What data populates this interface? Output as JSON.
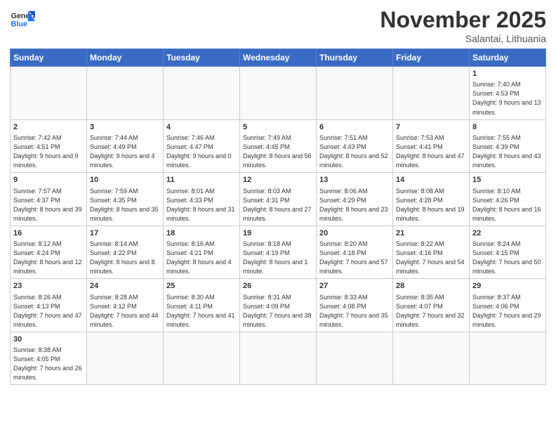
{
  "header": {
    "logo_general": "General",
    "logo_blue": "Blue",
    "month_title": "November 2025",
    "location": "Salantai, Lithuania"
  },
  "days_of_week": [
    "Sunday",
    "Monday",
    "Tuesday",
    "Wednesday",
    "Thursday",
    "Friday",
    "Saturday"
  ],
  "weeks": [
    {
      "days": [
        {
          "num": "",
          "info": ""
        },
        {
          "num": "",
          "info": ""
        },
        {
          "num": "",
          "info": ""
        },
        {
          "num": "",
          "info": ""
        },
        {
          "num": "",
          "info": ""
        },
        {
          "num": "",
          "info": ""
        },
        {
          "num": "1",
          "info": "Sunrise: 7:40 AM\nSunset: 4:53 PM\nDaylight: 9 hours and 13 minutes."
        }
      ]
    },
    {
      "days": [
        {
          "num": "2",
          "info": "Sunrise: 7:42 AM\nSunset: 4:51 PM\nDaylight: 9 hours and 9 minutes."
        },
        {
          "num": "3",
          "info": "Sunrise: 7:44 AM\nSunset: 4:49 PM\nDaylight: 9 hours and 4 minutes."
        },
        {
          "num": "4",
          "info": "Sunrise: 7:46 AM\nSunset: 4:47 PM\nDaylight: 9 hours and 0 minutes."
        },
        {
          "num": "5",
          "info": "Sunrise: 7:49 AM\nSunset: 4:45 PM\nDaylight: 8 hours and 56 minutes."
        },
        {
          "num": "6",
          "info": "Sunrise: 7:51 AM\nSunset: 4:43 PM\nDaylight: 8 hours and 52 minutes."
        },
        {
          "num": "7",
          "info": "Sunrise: 7:53 AM\nSunset: 4:41 PM\nDaylight: 8 hours and 47 minutes."
        },
        {
          "num": "8",
          "info": "Sunrise: 7:55 AM\nSunset: 4:39 PM\nDaylight: 8 hours and 43 minutes."
        }
      ]
    },
    {
      "days": [
        {
          "num": "9",
          "info": "Sunrise: 7:57 AM\nSunset: 4:37 PM\nDaylight: 8 hours and 39 minutes."
        },
        {
          "num": "10",
          "info": "Sunrise: 7:59 AM\nSunset: 4:35 PM\nDaylight: 8 hours and 35 minutes."
        },
        {
          "num": "11",
          "info": "Sunrise: 8:01 AM\nSunset: 4:33 PM\nDaylight: 8 hours and 31 minutes."
        },
        {
          "num": "12",
          "info": "Sunrise: 8:03 AM\nSunset: 4:31 PM\nDaylight: 8 hours and 27 minutes."
        },
        {
          "num": "13",
          "info": "Sunrise: 8:06 AM\nSunset: 4:29 PM\nDaylight: 8 hours and 23 minutes."
        },
        {
          "num": "14",
          "info": "Sunrise: 8:08 AM\nSunset: 4:28 PM\nDaylight: 8 hours and 19 minutes."
        },
        {
          "num": "15",
          "info": "Sunrise: 8:10 AM\nSunset: 4:26 PM\nDaylight: 8 hours and 16 minutes."
        }
      ]
    },
    {
      "days": [
        {
          "num": "16",
          "info": "Sunrise: 8:12 AM\nSunset: 4:24 PM\nDaylight: 8 hours and 12 minutes."
        },
        {
          "num": "17",
          "info": "Sunrise: 8:14 AM\nSunset: 4:22 PM\nDaylight: 8 hours and 8 minutes."
        },
        {
          "num": "18",
          "info": "Sunrise: 8:16 AM\nSunset: 4:21 PM\nDaylight: 8 hours and 4 minutes."
        },
        {
          "num": "19",
          "info": "Sunrise: 8:18 AM\nSunset: 4:19 PM\nDaylight: 8 hours and 1 minute."
        },
        {
          "num": "20",
          "info": "Sunrise: 8:20 AM\nSunset: 4:18 PM\nDaylight: 7 hours and 57 minutes."
        },
        {
          "num": "21",
          "info": "Sunrise: 8:22 AM\nSunset: 4:16 PM\nDaylight: 7 hours and 54 minutes."
        },
        {
          "num": "22",
          "info": "Sunrise: 8:24 AM\nSunset: 4:15 PM\nDaylight: 7 hours and 50 minutes."
        }
      ]
    },
    {
      "days": [
        {
          "num": "23",
          "info": "Sunrise: 8:26 AM\nSunset: 4:13 PM\nDaylight: 7 hours and 47 minutes."
        },
        {
          "num": "24",
          "info": "Sunrise: 8:28 AM\nSunset: 4:12 PM\nDaylight: 7 hours and 44 minutes."
        },
        {
          "num": "25",
          "info": "Sunrise: 8:30 AM\nSunset: 4:11 PM\nDaylight: 7 hours and 41 minutes."
        },
        {
          "num": "26",
          "info": "Sunrise: 8:31 AM\nSunset: 4:09 PM\nDaylight: 7 hours and 38 minutes."
        },
        {
          "num": "27",
          "info": "Sunrise: 8:33 AM\nSunset: 4:08 PM\nDaylight: 7 hours and 35 minutes."
        },
        {
          "num": "28",
          "info": "Sunrise: 8:35 AM\nSunset: 4:07 PM\nDaylight: 7 hours and 32 minutes."
        },
        {
          "num": "29",
          "info": "Sunrise: 8:37 AM\nSunset: 4:06 PM\nDaylight: 7 hours and 29 minutes."
        }
      ]
    },
    {
      "days": [
        {
          "num": "30",
          "info": "Sunrise: 8:38 AM\nSunset: 4:05 PM\nDaylight: 7 hours and 26 minutes."
        },
        {
          "num": "",
          "info": ""
        },
        {
          "num": "",
          "info": ""
        },
        {
          "num": "",
          "info": ""
        },
        {
          "num": "",
          "info": ""
        },
        {
          "num": "",
          "info": ""
        },
        {
          "num": "",
          "info": ""
        }
      ]
    }
  ]
}
